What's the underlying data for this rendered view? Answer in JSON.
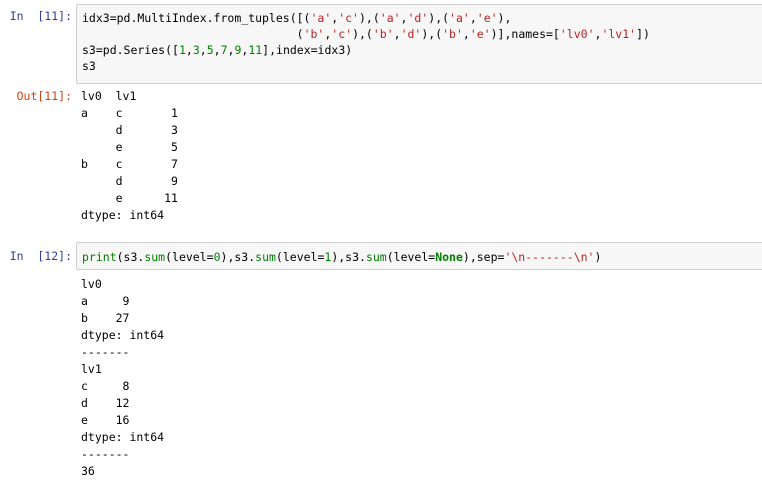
{
  "cells": [
    {
      "in_prompt": "In  [11]:",
      "code_lines": [
        "idx3=pd.MultiIndex.from_tuples([('a','c'),('a','d'),('a','e'),",
        "                               ('b','c'),('b','d'),('b','e')],names=['lv0','lv1'])",
        "s3=pd.Series([1,3,5,7,9,11],index=idx3)",
        "s3"
      ],
      "out_prompt": "Out[11]:",
      "output_lines": [
        "lv0  lv1",
        "a    c       1",
        "     d       3",
        "     e       5",
        "b    c       7",
        "     d       9",
        "     e      11",
        "dtype: int64"
      ]
    },
    {
      "in_prompt": "In  [12]:",
      "code_parts": [
        {
          "t": "print",
          "c": "bi"
        },
        {
          "t": "(s3.",
          "c": "op"
        },
        {
          "t": "sum",
          "c": "bi"
        },
        {
          "t": "(level=",
          "c": "op"
        },
        {
          "t": "0",
          "c": "num"
        },
        {
          "t": "),s3.",
          "c": "op"
        },
        {
          "t": "sum",
          "c": "bi"
        },
        {
          "t": "(level=",
          "c": "op"
        },
        {
          "t": "1",
          "c": "num"
        },
        {
          "t": "),s3.",
          "c": "op"
        },
        {
          "t": "sum",
          "c": "bi"
        },
        {
          "t": "(level=",
          "c": "op"
        },
        {
          "t": "None",
          "c": "kw"
        },
        {
          "t": "),sep=",
          "c": "op"
        },
        {
          "t": "'\\n-------\\n'",
          "c": "str"
        },
        {
          "t": ")",
          "c": "op"
        }
      ],
      "output_lines": [
        "lv0",
        "a     9",
        "b    27",
        "dtype: int64",
        "-------",
        "lv1",
        "c     8",
        "d    12",
        "e    16",
        "dtype: int64",
        "-------",
        "36"
      ]
    }
  ]
}
